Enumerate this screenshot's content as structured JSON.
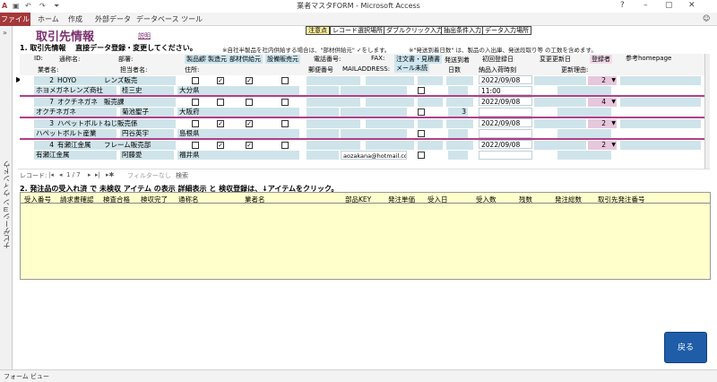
{
  "window": {
    "title": "業者マスタFORM - Microsoft Access",
    "help": "?",
    "minimize": "–",
    "maximize": "▢",
    "close": "✕",
    "user_icon": "☺"
  },
  "ribbon": {
    "tabs": [
      "ファイル",
      "ホーム",
      "作成",
      "外部データ",
      "データベース ツール"
    ]
  },
  "navpane": {
    "label": "ナビゲーション ウィンドウ",
    "chevron": "»"
  },
  "form": {
    "title": "取引先情報",
    "title_link": "説明",
    "buttons": [
      "注意点",
      "レコード選択場所",
      "ダブルクリック入力支援",
      "抽出条件入力",
      "データ入力場所"
    ],
    "section1": "1. 取引先情報　 直接データ登録・変更してください。",
    "note1": "※自社半製品を社内供給する場合は、\"部材供給元\"  ✓をします。",
    "note2": "※\"発送到着日数\" は、製品の入出庫、発送段取り等  の工数を含めます。",
    "header_row1": {
      "id": "ID:",
      "vendor_name": "通称名:",
      "dept": "部署:",
      "customer": "製品顧客",
      "maker": "製造元",
      "supplier": "部材供給元",
      "equipment": "設備販売元",
      "phone": "電話番号:",
      "fax": "FAX:",
      "order": "注文書・見積書",
      "ship_days": "発送到着",
      "first_date": "初回登録日",
      "changed": "変更更新日",
      "registrant": "登録者",
      "homepage": "参考homepage"
    },
    "header_row2": {
      "company": "業者名:",
      "person": "担当者名:",
      "address": "住所:",
      "zip": "郵便番号",
      "mail": "MAILADDRESS:",
      "email": "メール未読",
      "days": "日数",
      "ship_time": "納品入荷時刻",
      "reason": "更新理由:"
    },
    "records": [
      {
        "id": "2",
        "name": "HOYO",
        "dept": "レンズ販売",
        "company": "ホヨメガネレンズ商社",
        "person": "桂三史",
        "address": "大分県",
        "date": "2022/09/08",
        "time": "11:00",
        "registrant": "2",
        "mail": "",
        "days": "",
        "selector": "▶"
      },
      {
        "id": "7",
        "name": "オクチネガネ",
        "dept": "販売課",
        "company": "オクチネガネ",
        "person": "菊池聖子",
        "address": "大阪府",
        "date": "2022/09/08",
        "time": "",
        "registrant": "4",
        "mail": "",
        "days": "3",
        "selector": ""
      },
      {
        "id": "3",
        "name": "ハペットボルト",
        "dept": "ねじ販売係",
        "company": "ハペットボルト産業",
        "person": "円谷英宇",
        "address": "島根県",
        "date": "2022/09/08",
        "time": "",
        "registrant": "2",
        "mail": "",
        "days": "",
        "selector": ""
      },
      {
        "id": "4",
        "name": "有瀬江金属",
        "dept": "フレーム販売部",
        "company": "有瀬江金属",
        "person": "阿藤愛",
        "address": "福井県",
        "date": "2022/09/08",
        "time": "",
        "registrant": "2",
        "mail": "aozakana@hotmail.co.",
        "days": "",
        "selector": ""
      }
    ],
    "navbar": {
      "record_label": "レコード:",
      "first": "|◂",
      "prev": "◂",
      "position": "1 / 7",
      "next": "▸",
      "last": "▸|",
      "new": "▸✱",
      "filter": "フィルターなし",
      "search": "検索"
    },
    "section2": "2. 発注品の受入れ済  で  未検収  アイテム  の表示   詳細表示  と  検収登録は、↓アイテムをクリック。",
    "sub_headers": [
      "受入番号",
      "請求書確認",
      "検査合格",
      "検収完了",
      "通称名",
      "業者名",
      "部品KEY",
      "発注単価",
      "受入日",
      "受入数",
      "残数",
      "発注総数",
      "取引先発注番号"
    ],
    "back_button": "戻る"
  },
  "status": {
    "view": "フォーム ビュー"
  }
}
